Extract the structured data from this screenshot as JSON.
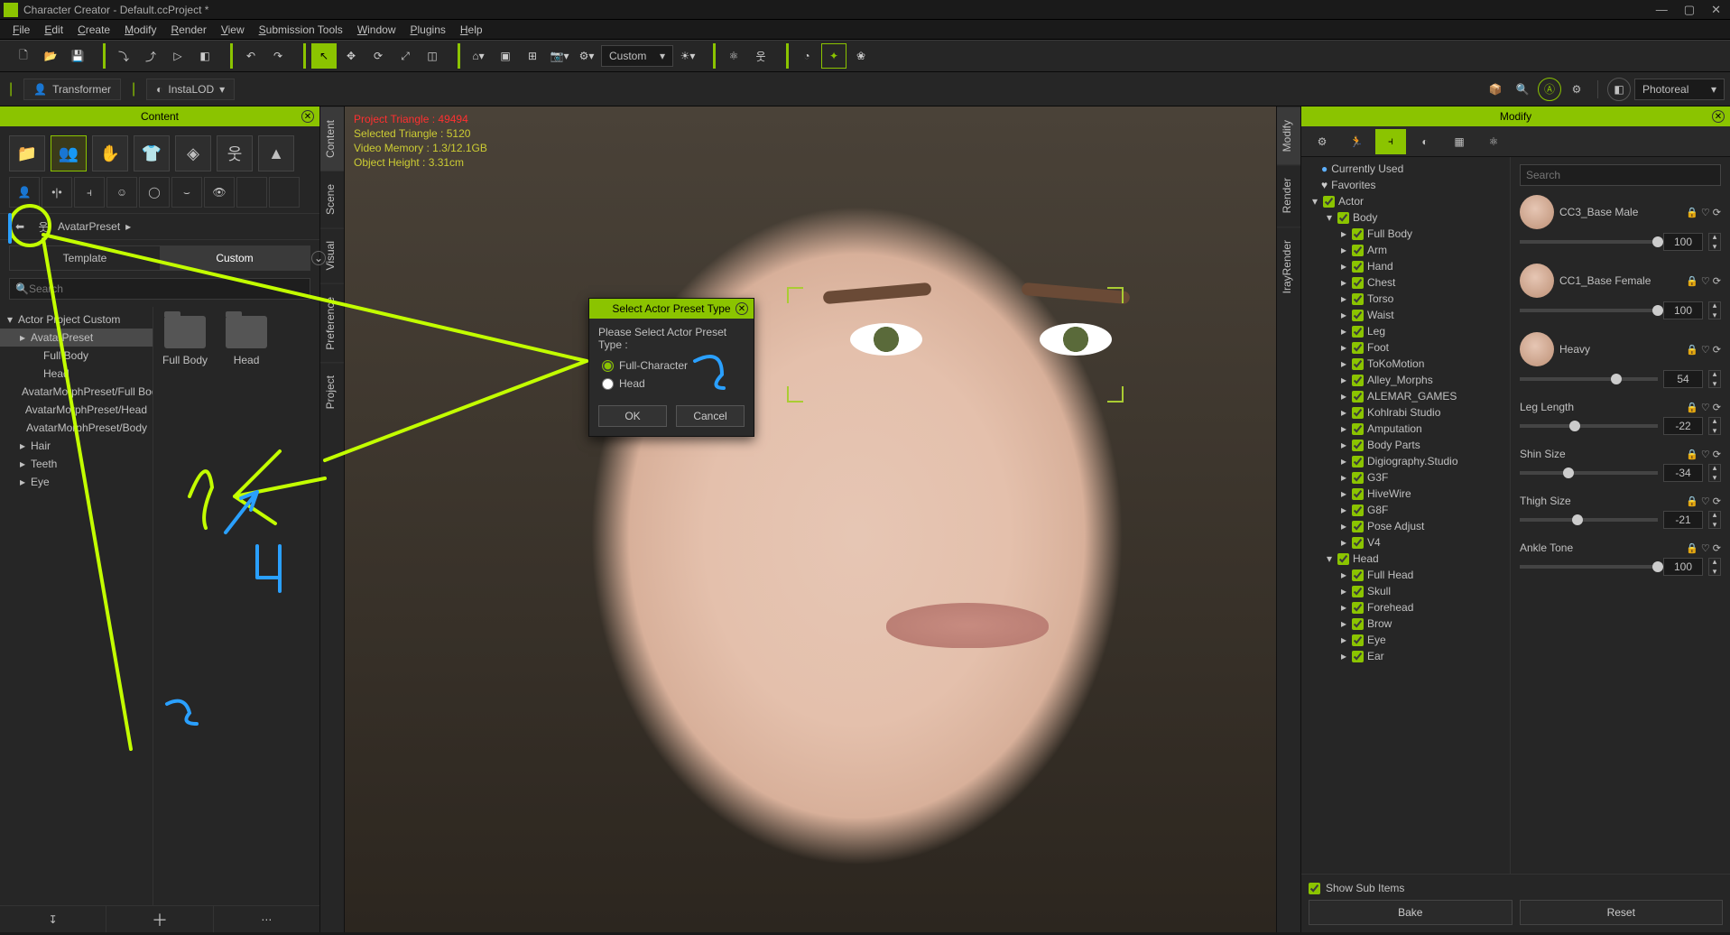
{
  "window": {
    "title": "Character Creator - Default.ccProject *"
  },
  "menu": [
    "File",
    "Edit",
    "Create",
    "Modify",
    "Render",
    "View",
    "Submission Tools",
    "Window",
    "Plugins",
    "Help"
  ],
  "toolbar_dropdown": "Custom",
  "tabs2": {
    "transformer": "Transformer",
    "instalod": "InstaLOD"
  },
  "render_mode": "Photoreal",
  "left": {
    "panel_title": "Content",
    "breadcrumb": "AvatarPreset",
    "tab_template": "Template",
    "tab_custom": "Custom",
    "search_placeholder": "Search",
    "tree": [
      {
        "label": "Actor Project Custom",
        "depth": 0,
        "expand": "▾"
      },
      {
        "label": "AvatarPreset",
        "depth": 1,
        "sel": true,
        "expand": "▸"
      },
      {
        "label": "Full Body",
        "depth": 2
      },
      {
        "label": "Head",
        "depth": 2
      },
      {
        "label": "AvatarMorphPreset/Full Body",
        "depth": 1
      },
      {
        "label": "AvatarMorphPreset/Head",
        "depth": 1
      },
      {
        "label": "AvatarMorphPreset/Body",
        "depth": 1
      },
      {
        "label": "Hair",
        "depth": 1,
        "expand": "▸"
      },
      {
        "label": "Teeth",
        "depth": 1,
        "expand": "▸"
      },
      {
        "label": "Eye",
        "depth": 1,
        "expand": "▸"
      }
    ],
    "thumbs": [
      "Full Body",
      "Head"
    ]
  },
  "vtabs_left": [
    "Content",
    "Scene",
    "Visual",
    "Preference",
    "Project"
  ],
  "vtabs_right": [
    "Modify",
    "Render",
    "IrayRender"
  ],
  "viewport_stats": {
    "l1a": "Project Triangle :",
    "l1b": "49494",
    "l2": "Selected Triangle : 5120",
    "l3": "Video Memory : 1.3/12.1GB",
    "l4": "Object Height : 3.31cm"
  },
  "dialog": {
    "title": "Select Actor Preset Type",
    "prompt": "Please Select Actor Preset Type :",
    "opt1": "Full-Character",
    "opt2": "Head",
    "ok": "OK",
    "cancel": "Cancel"
  },
  "modify": {
    "panel_title": "Modify",
    "search_placeholder": "Search",
    "tree_top": [
      {
        "icon": "●",
        "label": "Currently Used",
        "color": "#5eb0ff"
      },
      {
        "icon": "♥",
        "label": "Favorites"
      }
    ],
    "tree": [
      {
        "label": "Actor",
        "d": 0,
        "exp": "▾",
        "chk": true
      },
      {
        "label": "Body",
        "d": 1,
        "exp": "▾",
        "chk": true
      },
      {
        "label": "Full Body",
        "d": 2,
        "chk": true
      },
      {
        "label": "Arm",
        "d": 2,
        "chk": true
      },
      {
        "label": "Hand",
        "d": 2,
        "chk": true
      },
      {
        "label": "Chest",
        "d": 2,
        "chk": true
      },
      {
        "label": "Torso",
        "d": 2,
        "chk": true
      },
      {
        "label": "Waist",
        "d": 2,
        "chk": true
      },
      {
        "label": "Leg",
        "d": 2,
        "chk": true
      },
      {
        "label": "Foot",
        "d": 2,
        "chk": true
      },
      {
        "label": "ToKoMotion",
        "d": 2,
        "exp": "▸",
        "chk": true
      },
      {
        "label": "Alley_Morphs",
        "d": 2,
        "exp": "▸",
        "chk": true
      },
      {
        "label": "ALEMAR_GAMES",
        "d": 2,
        "exp": "▸",
        "chk": true
      },
      {
        "label": "Kohlrabi Studio",
        "d": 2,
        "chk": true
      },
      {
        "label": "Amputation",
        "d": 2,
        "chk": true
      },
      {
        "label": "Body Parts",
        "d": 2,
        "chk": true
      },
      {
        "label": "Digiography.Studio",
        "d": 2,
        "exp": "▸",
        "chk": true
      },
      {
        "label": "G3F",
        "d": 2,
        "exp": "▸",
        "chk": true
      },
      {
        "label": "HiveWire",
        "d": 2,
        "exp": "▸",
        "chk": true
      },
      {
        "label": "G8F",
        "d": 2,
        "exp": "▸",
        "chk": true
      },
      {
        "label": "Pose Adjust",
        "d": 2,
        "exp": "▸",
        "chk": true
      },
      {
        "label": "V4",
        "d": 2,
        "exp": "▸",
        "chk": true
      },
      {
        "label": "Head",
        "d": 1,
        "exp": "▾",
        "chk": true
      },
      {
        "label": "Full Head",
        "d": 2,
        "chk": true
      },
      {
        "label": "Skull",
        "d": 2,
        "chk": true
      },
      {
        "label": "Forehead",
        "d": 2,
        "chk": true
      },
      {
        "label": "Brow",
        "d": 2,
        "chk": true
      },
      {
        "label": "Eye",
        "d": 2,
        "chk": true
      },
      {
        "label": "Ear",
        "d": 2,
        "chk": true
      }
    ],
    "sliders": [
      {
        "name": "CC3_Base Male",
        "val": 100,
        "pct": 100,
        "thumb": true
      },
      {
        "name": "CC1_Base Female",
        "val": 100,
        "pct": 100,
        "thumb": true
      },
      {
        "name": "Heavy",
        "val": 54,
        "pct": 70,
        "thumb": true
      },
      {
        "name": "Leg Length",
        "val": -22,
        "pct": 40
      },
      {
        "name": "Shin Size",
        "val": -34,
        "pct": 35
      },
      {
        "name": "Thigh Size",
        "val": -21,
        "pct": 42
      },
      {
        "name": "Ankle Tone",
        "val": 100,
        "pct": 100
      }
    ],
    "show_sub": "Show Sub Items",
    "bake": "Bake",
    "reset": "Reset"
  },
  "annotations": {
    "n2": "2",
    "n3": "3",
    "n4": "4"
  }
}
